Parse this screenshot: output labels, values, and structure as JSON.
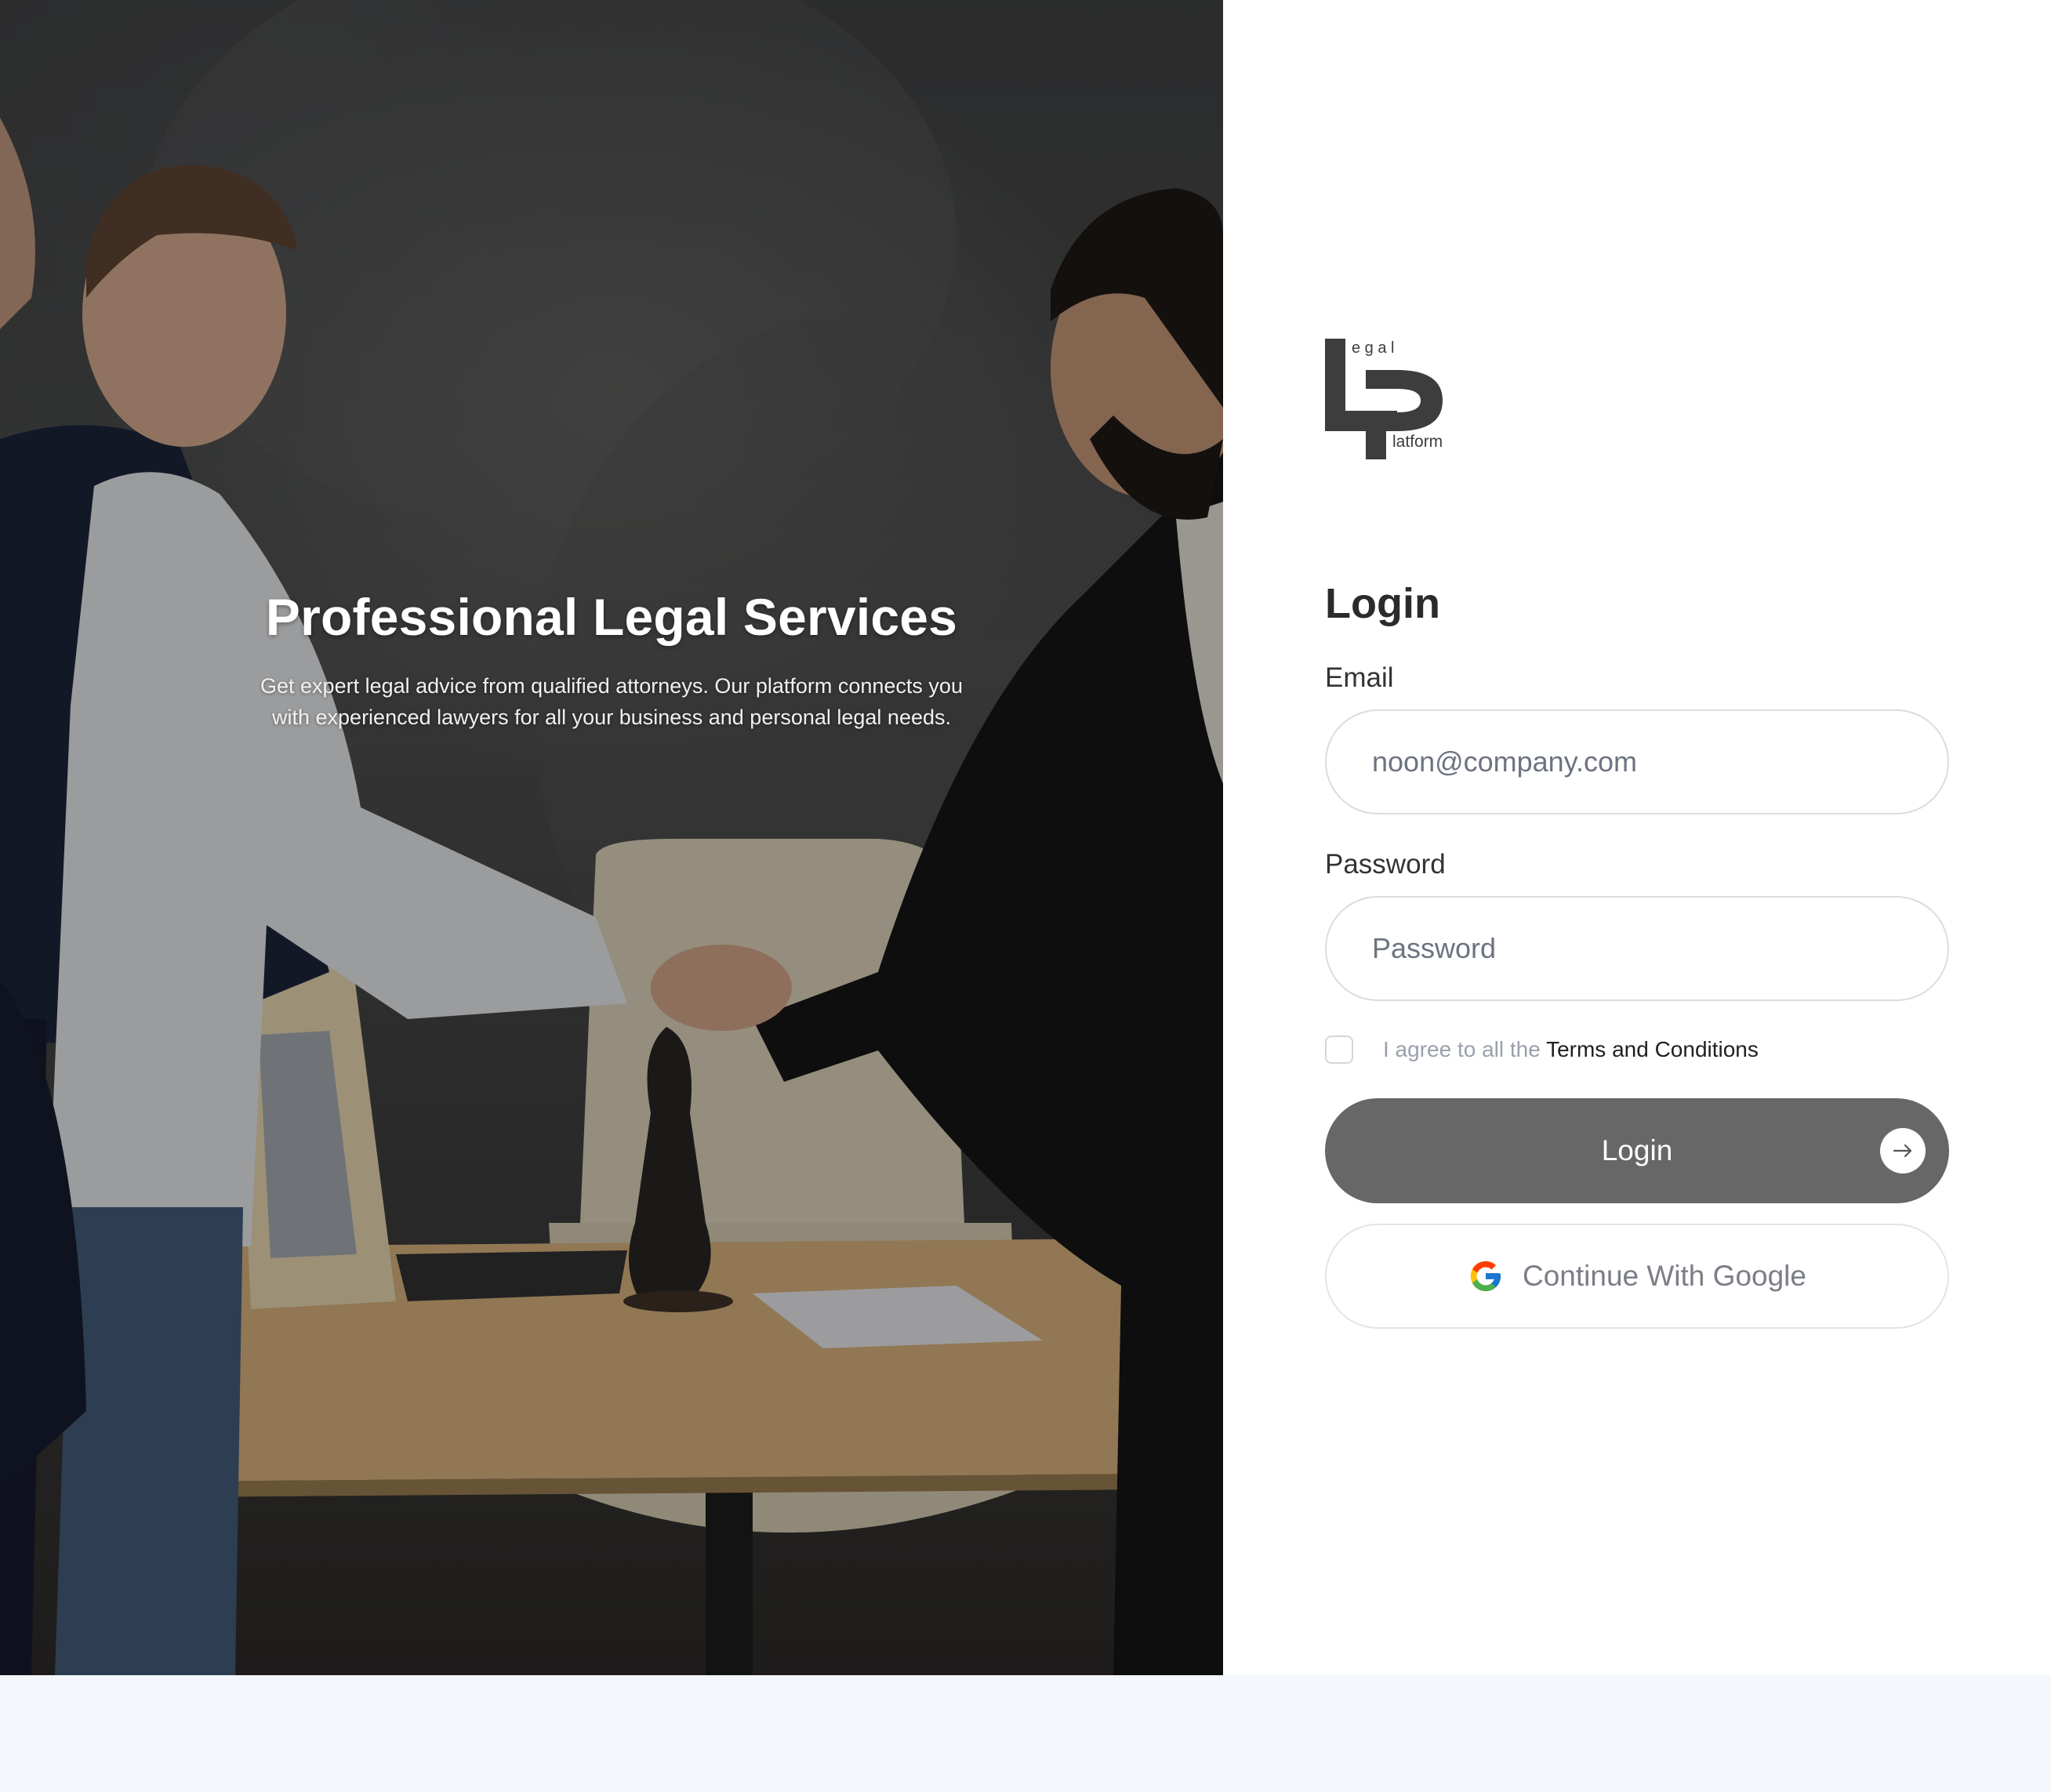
{
  "hero": {
    "title": "Professional Legal Services",
    "subtitle": "Get expert legal advice from qualified attorneys. Our platform connects you with experienced lawyers for all your business and personal legal needs."
  },
  "logo": {
    "top_text": "e g a l",
    "bottom_text": "latform",
    "icon": "legal-platform-logo"
  },
  "login": {
    "title": "Login",
    "email_label": "Email",
    "email_placeholder": "noon@company.com",
    "password_label": "Password",
    "password_placeholder": "Password",
    "terms_prefix": "I agree to all the ",
    "terms_link": "Terms and Conditions",
    "terms_checked": false,
    "submit_label": "Login",
    "submit_icon": "arrow-right-icon",
    "google_label": "Continue With Google",
    "google_icon": "google-icon"
  },
  "colors": {
    "button_bg": "#676767",
    "logo": "#3d3d3d",
    "page_bg": "#f4f7fb"
  }
}
